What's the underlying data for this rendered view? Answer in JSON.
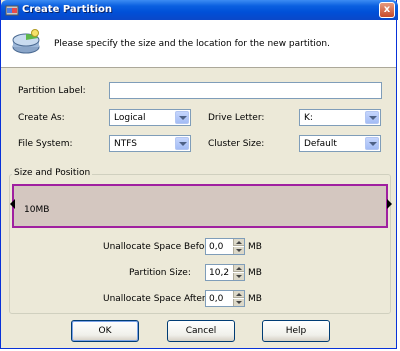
{
  "window": {
    "title": "Create Partition",
    "close_symbol": "x"
  },
  "header": {
    "instruction": "Please specify the size and the location for the new partition."
  },
  "form": {
    "partition_label": {
      "label": "Partition Label:",
      "value": ""
    },
    "create_as": {
      "label": "Create As:",
      "value": "Logical"
    },
    "drive_letter": {
      "label": "Drive Letter:",
      "value": "K:"
    },
    "file_system": {
      "label": "File System:",
      "value": "NTFS"
    },
    "cluster_size": {
      "label": "Cluster Size:",
      "value": "Default"
    }
  },
  "size_position": {
    "title": "Size and Position",
    "bar_label": "10MB",
    "unalloc_before": {
      "label": "Unallocate Space Before:",
      "value": "0,0",
      "unit": "MB"
    },
    "partition_size": {
      "label": "Partition Size:",
      "value": "10,2",
      "unit": "MB"
    },
    "unalloc_after": {
      "label": "Unallocate Space After:",
      "value": "0,0",
      "unit": "MB"
    }
  },
  "buttons": {
    "ok": "OK",
    "cancel": "Cancel",
    "help": "Help"
  },
  "colors": {
    "titlebar": "#0050d8",
    "partition_border": "#a020a0",
    "partition_fill": "#d4c7c0"
  }
}
